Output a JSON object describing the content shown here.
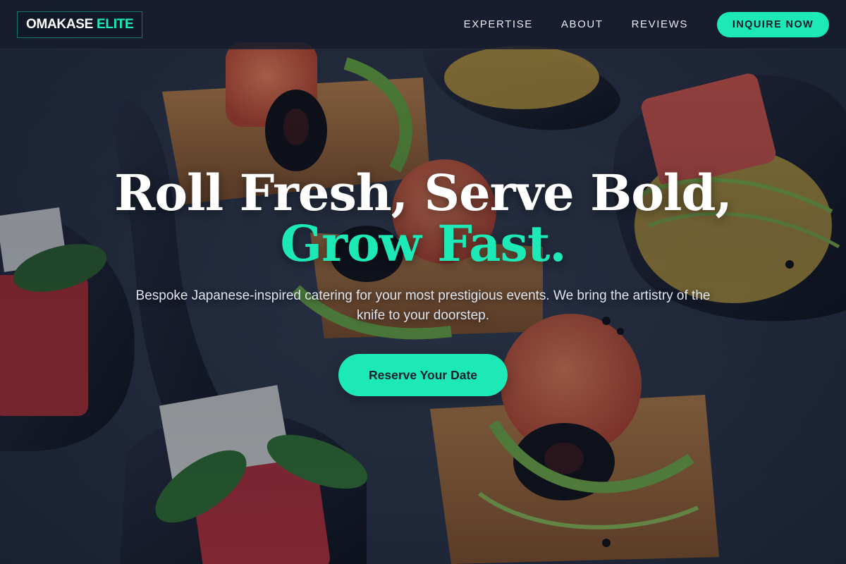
{
  "brand": {
    "name_main": "OMAKASE",
    "name_accent": "ELITE"
  },
  "nav": {
    "links": [
      "EXPERTISE",
      "ABOUT",
      "REVIEWS"
    ],
    "cta_label": "INQUIRE NOW"
  },
  "hero": {
    "title_line1": "Roll Fresh, Serve Bold,",
    "title_line2": "Grow Fast.",
    "subtitle": "Bespoke Japanese-inspired catering for your most prestigious events. We bring the artistry of the knife to your doorstep.",
    "cta_label": "Reserve Your Date"
  },
  "colors": {
    "accent": "#1de9b6",
    "navbar_bg": "#161c2c",
    "page_bg": "#1b2436"
  },
  "background_image": "catering-canapes-on-slate-photo"
}
